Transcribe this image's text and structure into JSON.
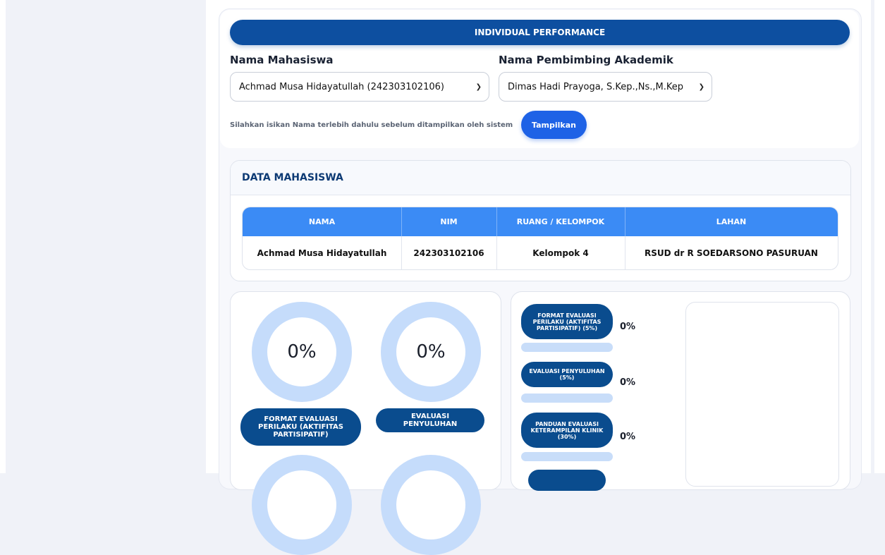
{
  "header": {
    "banner": "INDIVIDUAL PERFORMANCE"
  },
  "form": {
    "student_label": "Nama Mahasiswa",
    "student_value": "Achmad Musa Hidayatullah (242303102106)",
    "advisor_label": "Nama Pembimbing Akademik",
    "advisor_value": "Dimas Hadi Prayoga, S.Kep.,Ns.,M.Kep",
    "hint": "Silahkan isikan Nama terlebih dahulu sebelum ditampilkan oleh sistem",
    "submit_label": "Tampilkan"
  },
  "data_mahasiswa": {
    "title": "DATA MAHASISWA",
    "columns": [
      "NAMA",
      "NIM",
      "RUANG / KELOMPOK",
      "LAHAN"
    ],
    "row": [
      "Achmad Musa Hidayatullah",
      "242303102106",
      "Kelompok 4",
      "RSUD dr R SOEDARSONO PASURUAN"
    ]
  },
  "donuts": [
    {
      "value": "0%",
      "label": "FORMAT EVALUASI PERILAKU (AKTIFITAS PARTISIPATIF)"
    },
    {
      "value": "0%",
      "label": "EVALUASI PENYULUHAN"
    }
  ],
  "progress": [
    {
      "label": "FORMAT EVALUASI PERILAKU (AKTIFITAS PARTISIPATIF) (5%)",
      "value": "0%",
      "fraction": 0
    },
    {
      "label": "EVALUASI PENYULUHAN (5%)",
      "value": "0%",
      "fraction": 0
    },
    {
      "label": "PANDUAN EVALUASI KETERAMPILAN KLINIK (30%)",
      "value": "0%",
      "fraction": 0
    }
  ],
  "colors": {
    "primary": "#0d4fa0",
    "accent": "#1e62e6",
    "table_header": "#3b8bf5",
    "donut_ring": "#c5dcfb"
  }
}
